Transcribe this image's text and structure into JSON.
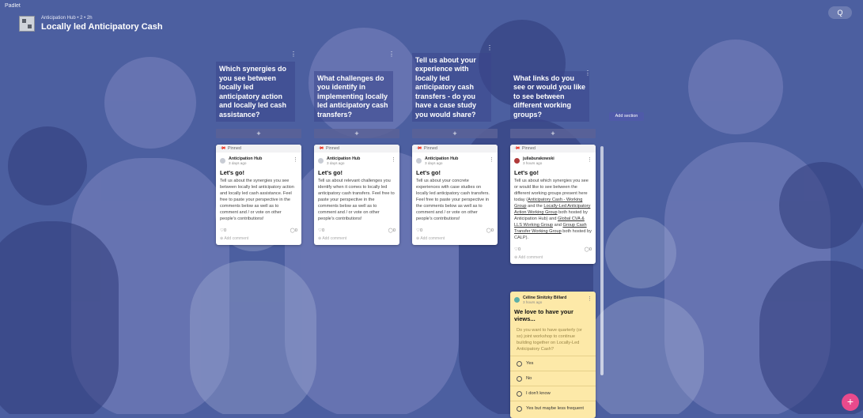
{
  "app": {
    "brand": "Padlet"
  },
  "board": {
    "meta": "Anticipation Hub • 2 • 2h",
    "title": "Locally led Anticipatory Cash"
  },
  "toolbar": {
    "search": "Q"
  },
  "columns": [
    {
      "title": "Which synergies do you see between locally led anticipatory action and locally led cash assistance?",
      "add": "+",
      "card": {
        "pinned": "Pinned",
        "author": "Anticipation Hub",
        "time": "3 days ago",
        "heading": "Let's go!",
        "body": "Tell us about the synergies you see between locally led anticipatory action and locally led cash assistance. Feel free to paste your perspective in the comments below as well as to comment and / or vote on other people's contributions!",
        "likes": "0",
        "comments": "0",
        "add_comment": "Add comment"
      }
    },
    {
      "title": "What challenges do you identify in implementing locally led anticipatory cash transfers?",
      "add": "+",
      "card": {
        "pinned": "Pinned",
        "author": "Anticipation Hub",
        "time": "3 days ago",
        "heading": "Let's go!",
        "body": "Tell us about relevant challenges you identify when it comes to locally led anticipatory cash transfers. Feel free to paste your perspective in the comments below as well as to comment and / or vote on other people's contributions!",
        "likes": "0",
        "comments": "0",
        "add_comment": "Add comment"
      }
    },
    {
      "title": "Tell us about your experience with locally led anticipatory cash transfers - do you have a case study you would share?",
      "add": "+",
      "card": {
        "pinned": "Pinned",
        "author": "Anticipation Hub",
        "time": "3 days ago",
        "heading": "Let's go!",
        "body": "Tell us about your concrete experiences with case studies on locally led anticipatory cash transfers. Feel free to paste your perspective in the comments below as well as to comment and / or vote on other people's contributions!",
        "likes": "0",
        "comments": "0",
        "add_comment": "Add comment"
      }
    },
    {
      "title": "What links do you see or would you like to see between different working groups?",
      "add": "+",
      "card": {
        "pinned": "Pinned",
        "author": "juliaburakowski",
        "time": "3 hours ago",
        "heading": "Let's go!",
        "body_start": "Tell us about which synergies you see or would like to see between the different working groups present here today (",
        "link1": "Anticipatory Cash - Working Group",
        "body_mid1": " and the ",
        "link2": "Locally-Led Anticipatory Action Working Group",
        "body_mid2": " both hosted by Anticipation Hub) and ",
        "link3": "Global CVA & LLS Working Group",
        "body_mid3": " and ",
        "link4": "Group Cash Transfer Working Group",
        "body_end": " both hosted by CALP).",
        "likes": "0",
        "comments": "0",
        "add_comment": "Add comment"
      },
      "poll": {
        "author": "Céline Sinitzky Billard",
        "time": "3 hours ago",
        "heading": "We love to have your views...",
        "question": "Do you want to have quarterly (or so) joint workshop to continue building together on Locally-Led Anticipatory Cash?",
        "options": [
          "Yes",
          "No",
          "I don't know",
          "Yes but maybe less frequent"
        ]
      }
    }
  ],
  "add_section": "Add section",
  "fab": "+",
  "colors": {
    "background": "#4c5fa0",
    "column_header": "#3a468c",
    "poll": "#fde9a8",
    "fab": "#e94a8c"
  }
}
